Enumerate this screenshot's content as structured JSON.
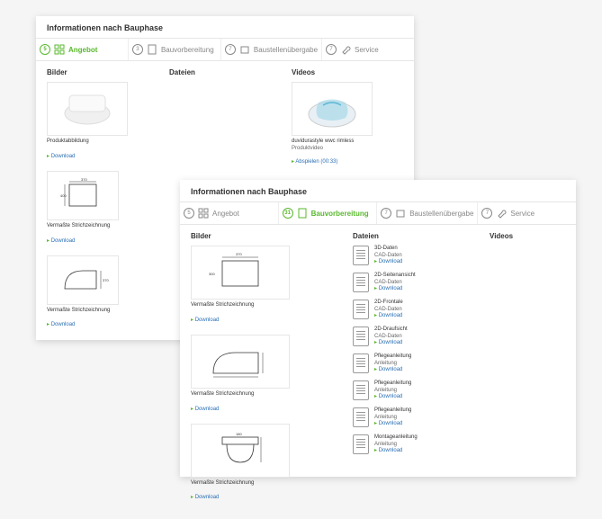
{
  "panelA": {
    "title": "Informationen nach Bauphase",
    "tabs": [
      {
        "num": "5",
        "label": "Angebot"
      },
      {
        "num": "3",
        "label": "Bauvorbereitung"
      },
      {
        "num": "7",
        "label": "Baustellenübergabe"
      },
      {
        "num": "7",
        "label": "Service"
      }
    ],
    "cols": {
      "bilder": "Bilder",
      "dateien": "Dateien",
      "videos": "Videos"
    },
    "items": {
      "img1": {
        "cap": "Produktabbildung",
        "dl": "Download"
      },
      "img2": {
        "cap": "Vermaßte Strichzeichnung",
        "dl": "Download"
      },
      "img3": {
        "cap": "Vermaßte Strichzeichnung",
        "dl": "Download"
      },
      "vid": {
        "cap": "duvidurastyle wwc rimless",
        "sub": "Produktvideo",
        "play": "Abspielen (00:33)"
      }
    }
  },
  "panelB": {
    "title": "Informationen nach Bauphase",
    "tabs": [
      {
        "num": "5",
        "label": "Angebot"
      },
      {
        "num": "31",
        "label": "Bauvorbereitung"
      },
      {
        "num": "7",
        "label": "Baustellenübergabe"
      },
      {
        "num": "7",
        "label": "Service"
      }
    ],
    "cols": {
      "bilder": "Bilder",
      "dateien": "Dateien",
      "videos": "Videos"
    },
    "bitems": [
      {
        "cap": "Vermaßte Strichzeichnung",
        "dl": "Download"
      },
      {
        "cap": "Vermaßte Strichzeichnung",
        "dl": "Download"
      },
      {
        "cap": "Vermaßte Strichzeichnung",
        "dl": "Download"
      }
    ],
    "files": [
      {
        "t": "3D-Daten",
        "s": "CAD-Daten",
        "dl": "Download"
      },
      {
        "t": "2D-Seitenansicht",
        "s": "CAD-Daten",
        "dl": "Download"
      },
      {
        "t": "2D-Frontale",
        "s": "CAD-Daten",
        "dl": "Download"
      },
      {
        "t": "2D-Draufsicht",
        "s": "CAD-Daten",
        "dl": "Download"
      },
      {
        "t": "Pflegeanleitung",
        "s": "Anleitung",
        "dl": "Download"
      },
      {
        "t": "Pflegeanleitung",
        "s": "Anleitung",
        "dl": "Download"
      },
      {
        "t": "Pflegeanleitung",
        "s": "Anleitung",
        "dl": "Download"
      },
      {
        "t": "Montageanleitung",
        "s": "Anleitung",
        "dl": "Download"
      }
    ]
  }
}
